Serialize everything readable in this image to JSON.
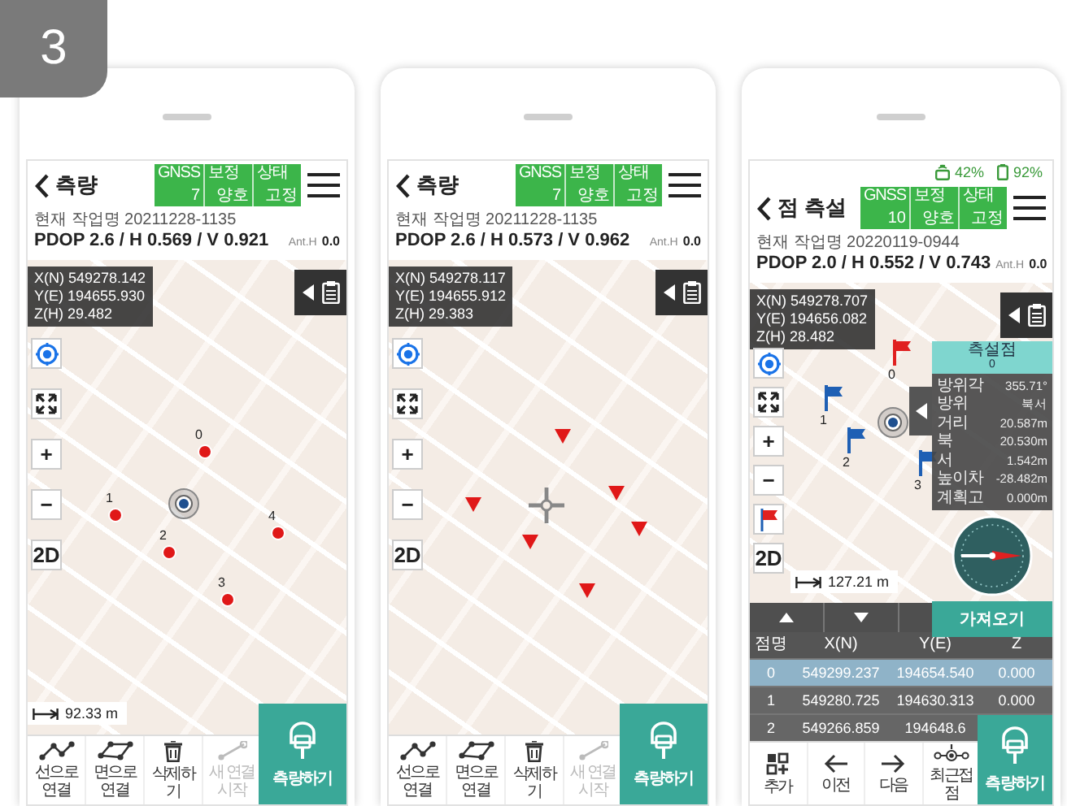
{
  "badge": "3",
  "phones": [
    {
      "kind": "survey",
      "title": "측량",
      "gnss": [
        {
          "label": "GNSS",
          "value": "7"
        },
        {
          "label": "보정",
          "value": "양호"
        },
        {
          "label": "상태",
          "value": "고정"
        }
      ],
      "work_name": "현재 작업명 20211228-1135",
      "dop": "PDOP 2.6 / H 0.569 / V 0.921",
      "ant_label": "Ant.H",
      "ant_value": "0.0",
      "coords": [
        "X(N) 549278.142",
        "Y(E) 194655.930",
        "Z(H) 29.482"
      ],
      "map_buttons": [
        {
          "kind": "locate"
        },
        {
          "kind": "expand"
        },
        {
          "kind": "text",
          "label": "+"
        },
        {
          "kind": "text",
          "label": "−"
        },
        {
          "kind": "text",
          "label": "2D"
        }
      ],
      "position_mark": {
        "kind": "target"
      },
      "markers": [
        {
          "kind": "dot",
          "label": "0"
        },
        {
          "kind": "dot",
          "label": "1"
        },
        {
          "kind": "dot",
          "label": "2"
        },
        {
          "kind": "dot",
          "label": "3"
        },
        {
          "kind": "dot",
          "label": "4"
        }
      ],
      "scale": "92.33 m",
      "tools": [
        {
          "kind": "line",
          "label": "선으로 연결",
          "disabled": false
        },
        {
          "kind": "polygon",
          "label": "면으로 연결",
          "disabled": false
        },
        {
          "kind": "delete",
          "label": "삭제하기",
          "disabled": false
        },
        {
          "kind": "new",
          "label": "새 연결 시작",
          "disabled": true
        }
      ],
      "survey_button": "측량하기"
    },
    {
      "kind": "survey",
      "title": "측량",
      "gnss": [
        {
          "label": "GNSS",
          "value": "7"
        },
        {
          "label": "보정",
          "value": "양호"
        },
        {
          "label": "상태",
          "value": "고정"
        }
      ],
      "work_name": "현재 작업명 20211228-1135",
      "dop": "PDOP 2.6 / H 0.573 / V 0.962",
      "ant_label": "Ant.H",
      "ant_value": "0.0",
      "coords": [
        "X(N) 549278.117",
        "Y(E) 194655.912",
        "Z(H) 29.383"
      ],
      "map_buttons": [
        {
          "kind": "locate"
        },
        {
          "kind": "expand"
        },
        {
          "kind": "text",
          "label": "+"
        },
        {
          "kind": "text",
          "label": "−"
        },
        {
          "kind": "text",
          "label": "2D"
        }
      ],
      "position_mark": {
        "kind": "crosshair"
      },
      "markers": [
        {
          "kind": "triangle"
        },
        {
          "kind": "triangle"
        },
        {
          "kind": "triangle"
        },
        {
          "kind": "triangle"
        },
        {
          "kind": "triangle"
        },
        {
          "kind": "triangle"
        }
      ],
      "tools": [
        {
          "kind": "line",
          "label": "선으로 연결",
          "disabled": false
        },
        {
          "kind": "polygon",
          "label": "면으로 연결",
          "disabled": false
        },
        {
          "kind": "delete",
          "label": "삭제하기",
          "disabled": false
        },
        {
          "kind": "new",
          "label": "새 연결 시작",
          "disabled": true
        }
      ],
      "survey_button": "측량하기"
    },
    {
      "kind": "stakeout",
      "status": [
        {
          "kind": "router",
          "text": "42%"
        },
        {
          "kind": "battery",
          "text": "92%"
        }
      ],
      "title": "점 측설",
      "gnss": [
        {
          "label": "GNSS",
          "value": "10"
        },
        {
          "label": "보정",
          "value": "양호"
        },
        {
          "label": "상태",
          "value": "고정"
        }
      ],
      "work_name": "현재 작업명 20220119-0944",
      "dop": "PDOP 2.0 / H 0.552 / V 0.743",
      "ant_label": "Ant.H",
      "ant_value": "0.0",
      "coords": [
        "X(N) 549278.707",
        "Y(E) 194656.082",
        "Z(H) 28.482"
      ],
      "map_buttons": [
        {
          "kind": "locate"
        },
        {
          "kind": "expand"
        },
        {
          "kind": "text",
          "label": "+"
        },
        {
          "kind": "text",
          "label": "−"
        },
        {
          "kind": "flag"
        },
        {
          "kind": "text",
          "label": "2D"
        }
      ],
      "position_mark": {
        "kind": "target"
      },
      "markers": [
        {
          "kind": "flag",
          "label": "0",
          "color": "#e02020"
        },
        {
          "kind": "flag",
          "label": "1",
          "color": "#1e5fb4"
        },
        {
          "kind": "flag",
          "label": "2",
          "color": "#1e5fb4"
        },
        {
          "kind": "flag",
          "label": "3",
          "color": "#1e5fb4"
        }
      ],
      "scale": "127.21 m",
      "stake_panel": {
        "title": "측설점",
        "point": "0",
        "rows": [
          {
            "label": "방위각",
            "value": "355.71°"
          },
          {
            "label": "방위",
            "value": "북서"
          },
          {
            "label": "거리",
            "value": "20.587m"
          },
          {
            "label": "북",
            "value": "20.530m"
          },
          {
            "label": "서",
            "value": "1.542m"
          },
          {
            "label": "높이차",
            "value": "-28.482m"
          },
          {
            "label": "계획고",
            "value": "0.000m"
          }
        ],
        "fetch_button": "가져오기"
      },
      "table": {
        "columns": [
          "점명",
          "X(N)",
          "Y(E)",
          "Z"
        ],
        "rows": [
          {
            "cells": [
              "0",
              "549299.237",
              "194654.540",
              "0.000"
            ],
            "selected": true
          },
          {
            "cells": [
              "1",
              "549280.725",
              "194630.313",
              "0.000"
            ],
            "selected": false
          },
          {
            "cells": [
              "2",
              "549266.859",
              "194648.6"
            ],
            "selected": false
          }
        ]
      },
      "tools": [
        {
          "kind": "add",
          "label": "추가"
        },
        {
          "kind": "prev",
          "label": "이전"
        },
        {
          "kind": "next",
          "label": "다음"
        },
        {
          "kind": "nearest",
          "label": "최근접점"
        }
      ],
      "survey_button": "측량하기"
    }
  ]
}
